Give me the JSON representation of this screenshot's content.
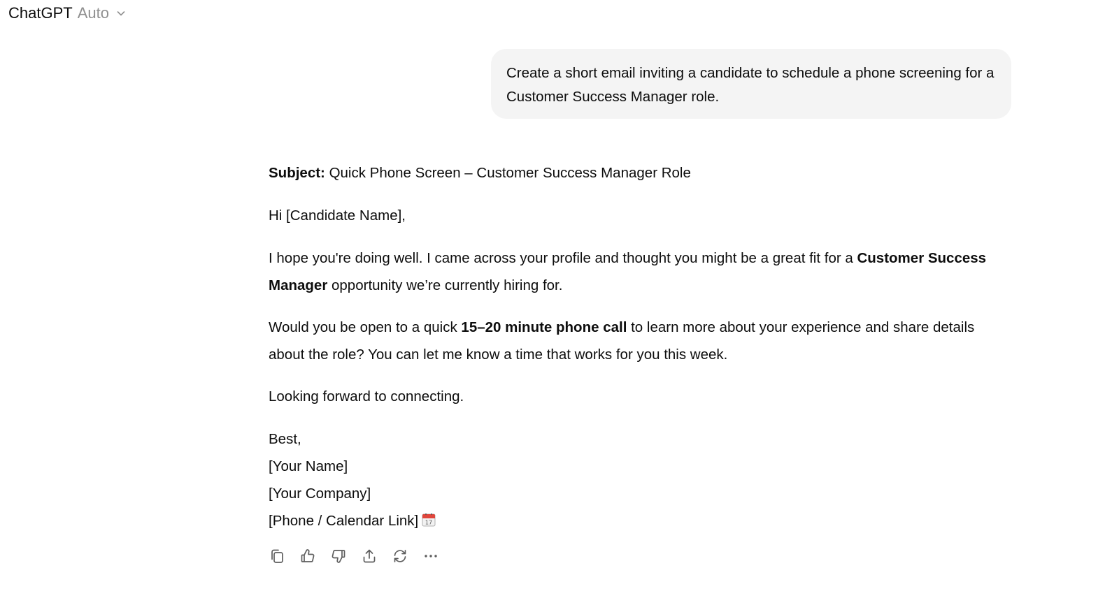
{
  "header": {
    "app_name": "ChatGPT",
    "model_label": "Auto"
  },
  "user_message": {
    "text": "Create a short email inviting a candidate to schedule a phone screening for a Customer Success Manager role."
  },
  "assistant_message": {
    "subject_label": "Subject:",
    "subject_text": " Quick Phone Screen – Customer Success Manager Role",
    "greeting": "Hi [Candidate Name],",
    "para1_a": "I hope you're doing well. I came across your profile and thought you might be a great fit for a ",
    "para1_bold": "Customer Success Manager",
    "para1_b": " opportunity we’re currently hiring for.",
    "para2_a": "Would you be open to a quick ",
    "para2_bold": "15–20 minute phone call",
    "para2_b": " to learn more about your experience and share details about the role? You can let me know a time that works for you this week.",
    "closing": "Looking forward to connecting.",
    "signoff": "Best,",
    "sig_name": "[Your Name]",
    "sig_company": "[Your Company]",
    "sig_link": "[Phone / Calendar Link]",
    "calendar_emoji_day": "17"
  },
  "actions": [
    "copy-icon",
    "thumbs-up-icon",
    "thumbs-down-icon",
    "share-icon",
    "regenerate-icon",
    "more-icon"
  ],
  "colors": {
    "text": "#0d0d0d",
    "muted": "#8f8f8f",
    "bubble": "#f4f4f4",
    "icon": "#5d5d5d"
  }
}
